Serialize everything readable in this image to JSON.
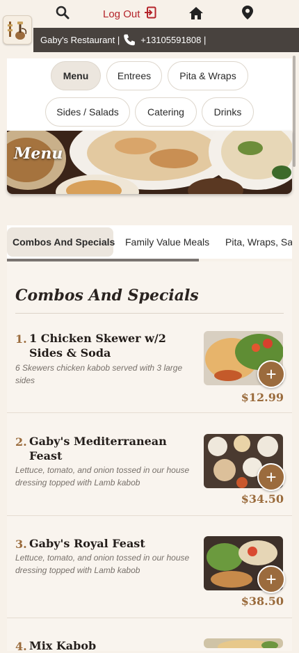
{
  "header": {
    "logout_label": "Log Out",
    "icons": [
      "search-icon",
      "logout-icon",
      "home-icon",
      "location-pin-icon"
    ]
  },
  "contact": {
    "restaurant_name": "Gaby's Restaurant |",
    "phone": "+13105591808 |"
  },
  "categories": [
    {
      "label": "Menu",
      "active": true
    },
    {
      "label": "Entrees",
      "active": false
    },
    {
      "label": "Pita & Wraps",
      "active": false
    },
    {
      "label": "Sides / Salads",
      "active": false
    },
    {
      "label": "Catering",
      "active": false
    },
    {
      "label": "Drinks",
      "active": false
    }
  ],
  "banner": {
    "title": "Menu"
  },
  "tabs": [
    {
      "label": "Combos And Specials",
      "active": true
    },
    {
      "label": "Family Value Meals",
      "active": false
    },
    {
      "label": "Pita, Wraps, Sar",
      "active": false
    }
  ],
  "section": {
    "title": "Combos And Specials"
  },
  "items": [
    {
      "num": "1.",
      "name": "1 Chicken Skewer w/2 Sides & Soda",
      "desc": "6 Skewers chicken kabob served with 3 large sides",
      "price": "$12.99"
    },
    {
      "num": "2.",
      "name": "Gaby's Mediterranean Feast",
      "desc": "Lettuce, tomato, and onion tossed in our house dressing topped with Lamb kabob",
      "price": "$34.50"
    },
    {
      "num": "3.",
      "name": "Gaby's Royal Feast",
      "desc": "Lettuce, tomato, and onion tossed in our house dressing topped with Lamb kabob",
      "price": "$38.50"
    },
    {
      "num": "4.",
      "name": "Mix Kabob",
      "desc": "",
      "price": ""
    }
  ],
  "add_button_label": "+",
  "colors": {
    "background": "#f7f1e9",
    "accent_brown": "#9b6b3d",
    "logout_red": "#b4242a",
    "contact_bar": "#48423e"
  }
}
